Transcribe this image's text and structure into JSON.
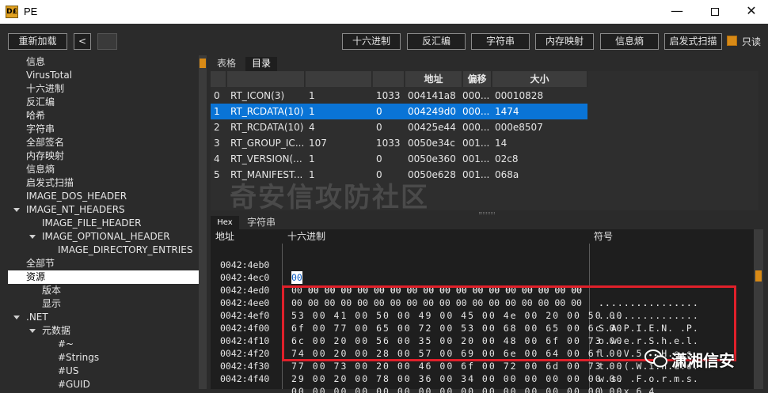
{
  "window": {
    "title": "PE",
    "icon_text": "D£"
  },
  "toolbar": {
    "reload_label": "重新加载",
    "back_label": "<",
    "buttons": [
      "十六进制",
      "反汇编",
      "字符串",
      "内存映射",
      "信息熵",
      "启发式扫描"
    ],
    "readonly_label": "只读",
    "readonly_checked": true
  },
  "tree": [
    "信息",
    "VirusTotal",
    "十六进制",
    "反汇编",
    "哈希",
    "字符串",
    "全部签名",
    "内存映射",
    "信息熵",
    "启发式扫描",
    "IMAGE_DOS_HEADER",
    "IMAGE_NT_HEADERS",
    "IMAGE_FILE_HEADER",
    "IMAGE_OPTIONAL_HEADER",
    "IMAGE_DIRECTORY_ENTRIES",
    "全部节",
    "资源",
    "版本",
    "显示",
    ".NET",
    "元数据",
    "#~",
    "#Strings",
    "#US",
    "#GUID"
  ],
  "upper_tabs": [
    "表格",
    "目录"
  ],
  "resource_table": {
    "headers": [
      "",
      "",
      "",
      "",
      "地址",
      "偏移",
      "大小"
    ],
    "rows": [
      [
        "0",
        "RT_ICON(3)",
        "1",
        "1033",
        "004141a8",
        "000...",
        "00010828"
      ],
      [
        "1",
        "RT_RCDATA(10)",
        "1",
        "0",
        "004249d0",
        "000...",
        "1474"
      ],
      [
        "2",
        "RT_RCDATA(10)",
        "4",
        "0",
        "00425e44",
        "000...",
        "000e8507"
      ],
      [
        "3",
        "RT_GROUP_IC...",
        "107",
        "1033",
        "0050e34c",
        "001...",
        "14"
      ],
      [
        "4",
        "RT_VERSION(...",
        "1",
        "0",
        "0050e360",
        "001...",
        "02c8"
      ],
      [
        "5",
        "RT_MANIFEST...",
        "1",
        "0",
        "0050e628",
        "001...",
        "068a"
      ]
    ],
    "selected_row": 1
  },
  "watermark": "奇安信攻防社区",
  "lower_tabs": [
    "Hex",
    "字符串"
  ],
  "hex_view": {
    "headers": {
      "address": "地址",
      "hex": "十六进制",
      "symbols": "符号"
    },
    "rows": [
      {
        "addr": "0042:4eb0",
        "hex": "00 00 00 00 00 00 00 00 00 00 00 00 00 00 00 00 00 00",
        "text": "................"
      },
      {
        "addr": "0042:4ec0",
        "hex": "00 00 00 00 00 00 00 00 00 00 00 00 00 00 00 00 00 00",
        "text": "................"
      },
      {
        "addr": "0042:4ed0",
        "hex": "00 00 00 00 00 00 00 00 00 00 00 00 00 00 00 00 00 00",
        "text": "................"
      },
      {
        "addr": "0042:4ee0",
        "hex": "53 00 41 00 50 00 49 00 45 00 4e 00 20 00 50 00",
        "text": "S.A.P.I.E.N. .P."
      },
      {
        "addr": "0042:4ef0",
        "hex": "6f 00 77 00 65 00 72 00 53 00 68 00 65 00 6c 00",
        "text": "o.w.e.r.S.h.e.l."
      },
      {
        "addr": "0042:4f00",
        "hex": "6c 00 20 00 56 00 35 00 20 00 48 00 6f 00 73 00",
        "text": "l. .V.5. .H.o.s."
      },
      {
        "addr": "0042:4f10",
        "hex": "74 00 20 00 28 00 57 00 69 00 6e 00 64 00 6f 00",
        "text": "t. .(.W.i.n.d.o."
      },
      {
        "addr": "0042:4f20",
        "hex": "77 00 73 00 20 00 46 00 6f 00 72 00 6d 00 73 00",
        "text": "w.s. .F.o.r.m.s."
      },
      {
        "addr": "0042:4f30",
        "hex": "29 00 20 00 78 00 36 00 34 00 00 00 00 00 00 00",
        "text": "). .x.6.4......."
      },
      {
        "addr": "0042:4f40",
        "hex": "00 00 00 00 00 00 00 00 00 00 00 00 00 00 00 00",
        "text": "................"
      }
    ]
  },
  "overlay_label": "潇湘信安",
  "colors": {
    "accent": "#d88a16",
    "selection": "#0a74d6",
    "highlight_box": "#e0202a"
  }
}
